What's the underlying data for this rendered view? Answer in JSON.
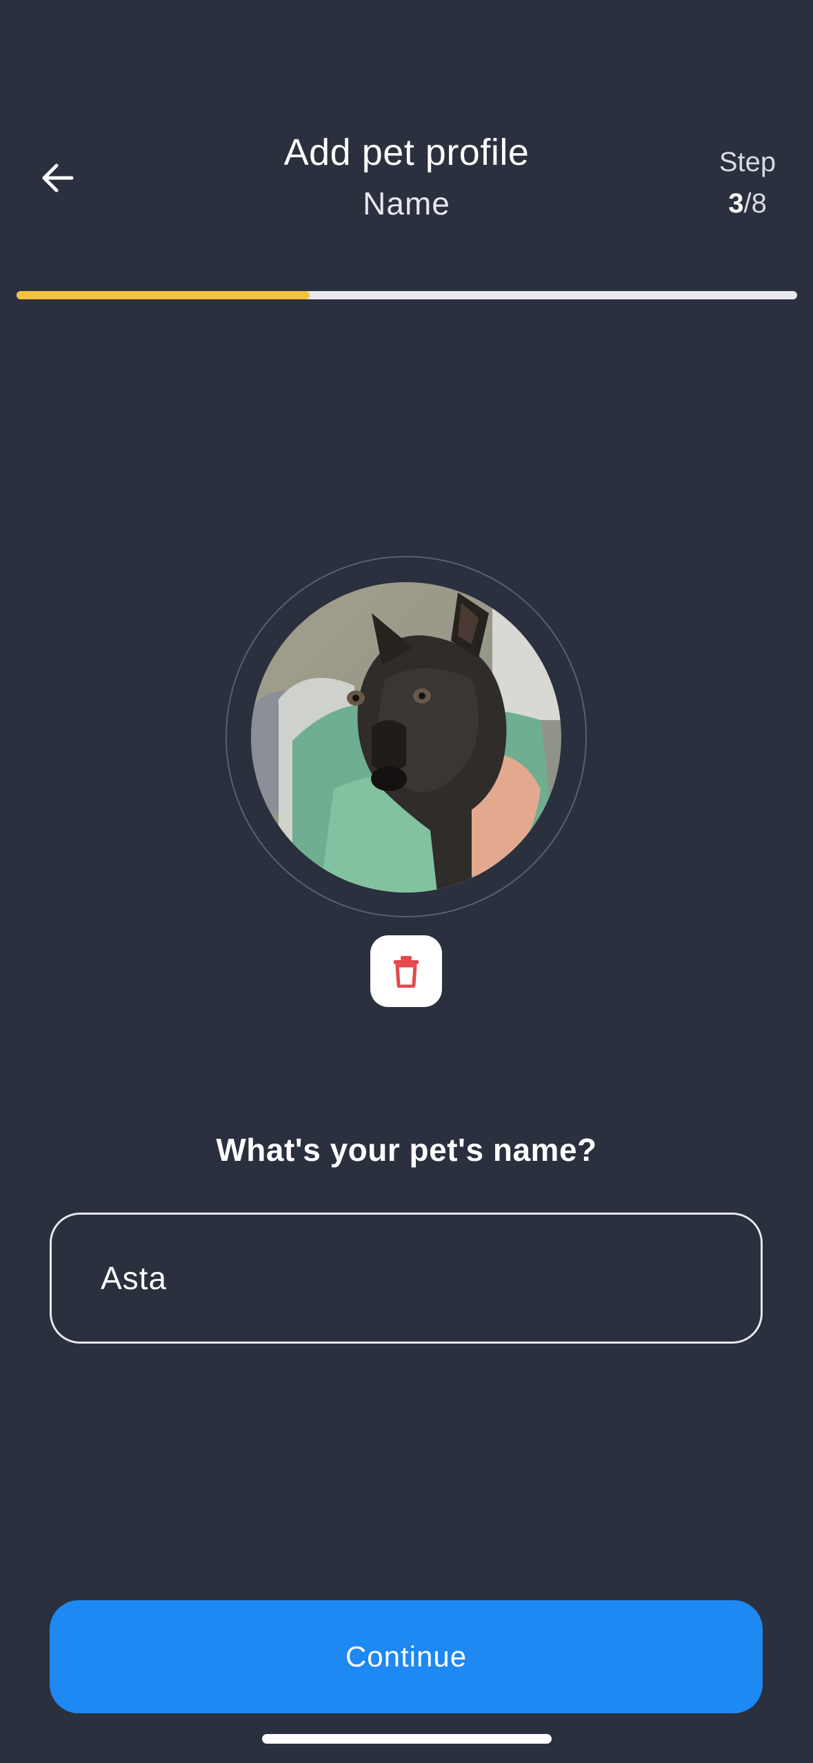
{
  "colors": {
    "background": "#2a303d",
    "progress_fill": "#f5c23e",
    "progress_track": "#e8e9ee",
    "primary_button": "#1e88f3",
    "delete_icon": "#e5484d"
  },
  "header": {
    "back_icon": "arrow-left-icon",
    "title": "Add pet profile",
    "subtitle": "Name",
    "step_label": "Step",
    "step_current": "3",
    "step_separator": "/",
    "step_total": "8"
  },
  "progress": {
    "fraction": 0.375
  },
  "photo": {
    "image_icon": "pet-photo",
    "delete_icon": "trash-icon"
  },
  "form": {
    "question": "What's your pet's name?",
    "name_value": "Asta"
  },
  "footer": {
    "continue_label": "Continue"
  }
}
